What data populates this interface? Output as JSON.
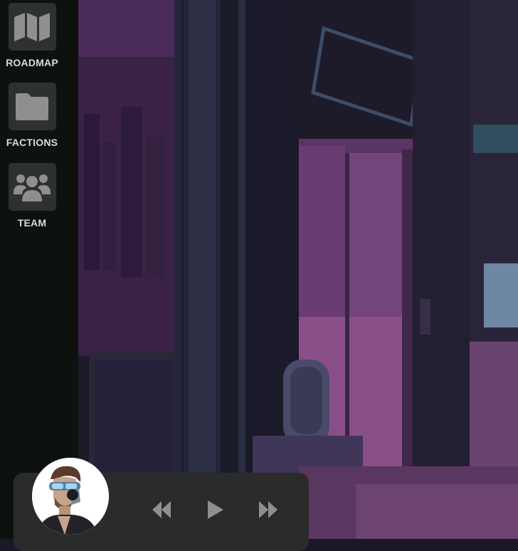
{
  "sidebar": {
    "items": [
      {
        "label": "ROADMAP",
        "icon": "map-icon"
      },
      {
        "label": "FACTIONS",
        "icon": "folder-icon"
      },
      {
        "label": "TEAM",
        "icon": "team-icon"
      }
    ]
  },
  "player": {
    "avatar": "cyborg-avatar",
    "controls": [
      "rewind-icon",
      "play-icon",
      "fast-forward-icon"
    ]
  },
  "colors": {
    "sidebar_bg": "#0d120f",
    "tile_bg": "#2e3130",
    "icon_gray": "#8e8f8f",
    "label_text": "#d9dcdb",
    "player_bg": "#2b2b2b",
    "scene_magenta": "#6e3a73"
  }
}
